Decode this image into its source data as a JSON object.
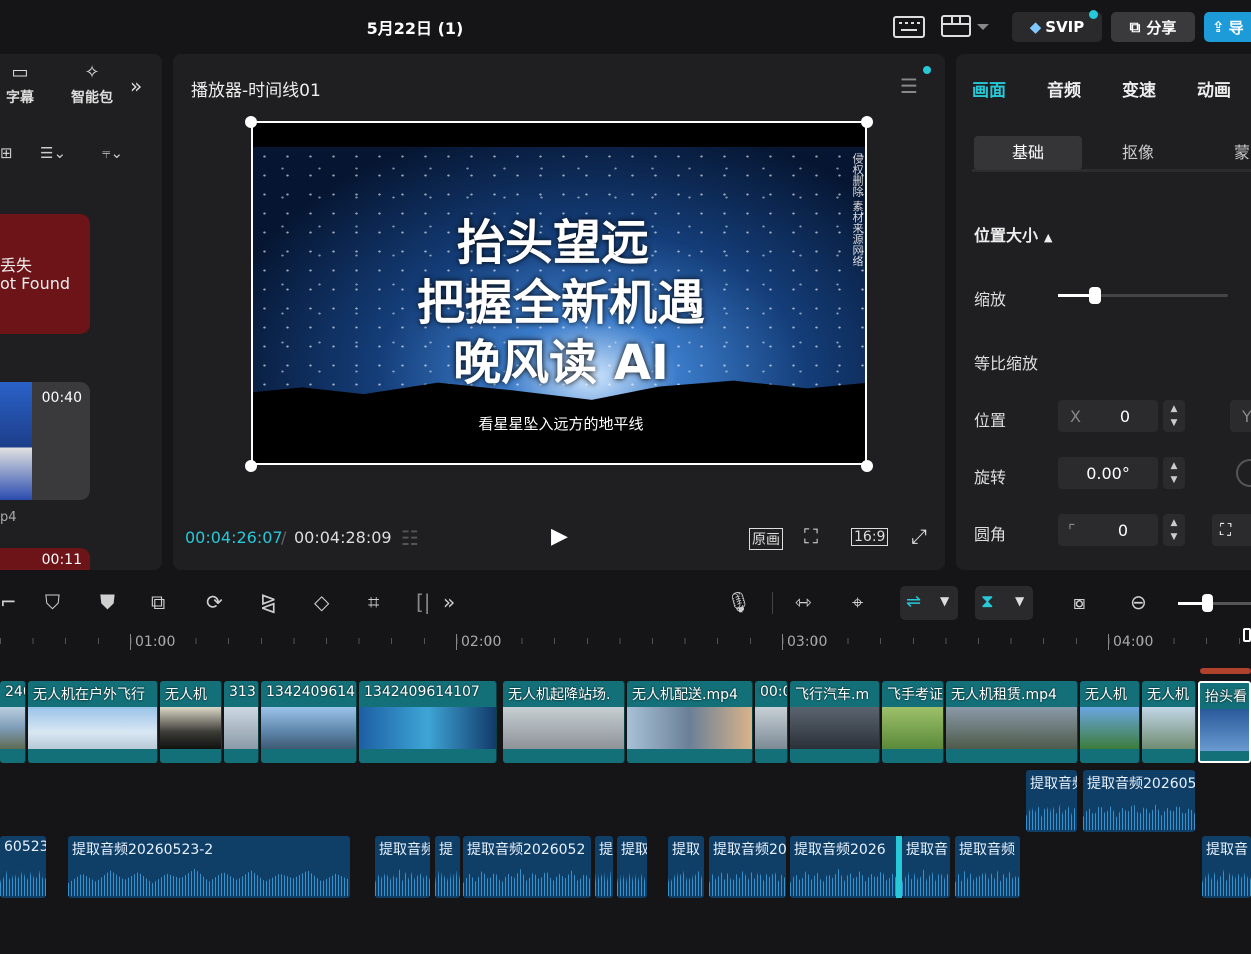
{
  "header": {
    "project_title": "5月22日 (1)",
    "svip_label": "SVIP",
    "share_label": "分享",
    "export_label": "导"
  },
  "left_panel": {
    "tools": [
      {
        "label": "字幕",
        "icon": "subtitle-icon"
      },
      {
        "label": "智能包",
        "icon": "sparkle-icon"
      }
    ],
    "error_line1": "丢失",
    "error_line2": "ot Found",
    "media_duration_1": "00:40",
    "media_name_1": "p4",
    "media_duration_2": "00:11"
  },
  "player": {
    "title": "播放器-时间线01",
    "overlay_line1": "抬头望远",
    "overlay_line2": "把握全新机遇",
    "overlay_line3": "晚风读 AI",
    "subtitle": "看星星坠入远方的地平线",
    "watermark": "侵权删除 素材来源网络",
    "current_time": "00:04:26:07",
    "separator": "/",
    "total_time": "00:04:28:09",
    "original_label": "原画",
    "ratio_label": "16:9"
  },
  "right_panel": {
    "tabs": [
      "画面",
      "音频",
      "变速",
      "动画"
    ],
    "active_tab": "画面",
    "subtabs": [
      "基础",
      "抠像",
      "蒙"
    ],
    "section_title": "位置大小",
    "scale_label": "缩放",
    "scale_value": 0.22,
    "uniform_scale_label": "等比缩放",
    "position_label": "位置",
    "x_label": "X",
    "x_value": "0",
    "y_label": "Y",
    "rotation_label": "旋转",
    "rotation_value": "0.00°",
    "corner_label": "圆角",
    "corner_value": "0"
  },
  "timeline": {
    "ruler_labels": [
      "01:00",
      "02:00",
      "03:00",
      "04:00"
    ],
    "video_clips": [
      "240",
      "无人机在户外飞行",
      "无人机",
      "313",
      "1342409614",
      "1342409614107",
      "无人机起降站场.",
      "无人机配送.mp4",
      "00:0",
      "飞行汽车.m",
      "飞手考证",
      "无人机租赁.mp4",
      "无人机",
      "无人机",
      "抬头看"
    ],
    "audio_track1": [
      "提取音频",
      "提取音频202605"
    ],
    "audio_track2": [
      "60523-",
      "提取音频20260523-2",
      "提取音频",
      "提",
      "提取音频2026052",
      "提",
      "提取",
      "提取",
      "提取音频20",
      "提取音频2026",
      "提取音",
      "提取音频",
      "提取音"
    ]
  },
  "colors": {
    "accent": "#27c8d8",
    "panel": "#1f1f21",
    "clip": "#137079",
    "audio": "#0f3e66",
    "error": "#6d1418"
  }
}
